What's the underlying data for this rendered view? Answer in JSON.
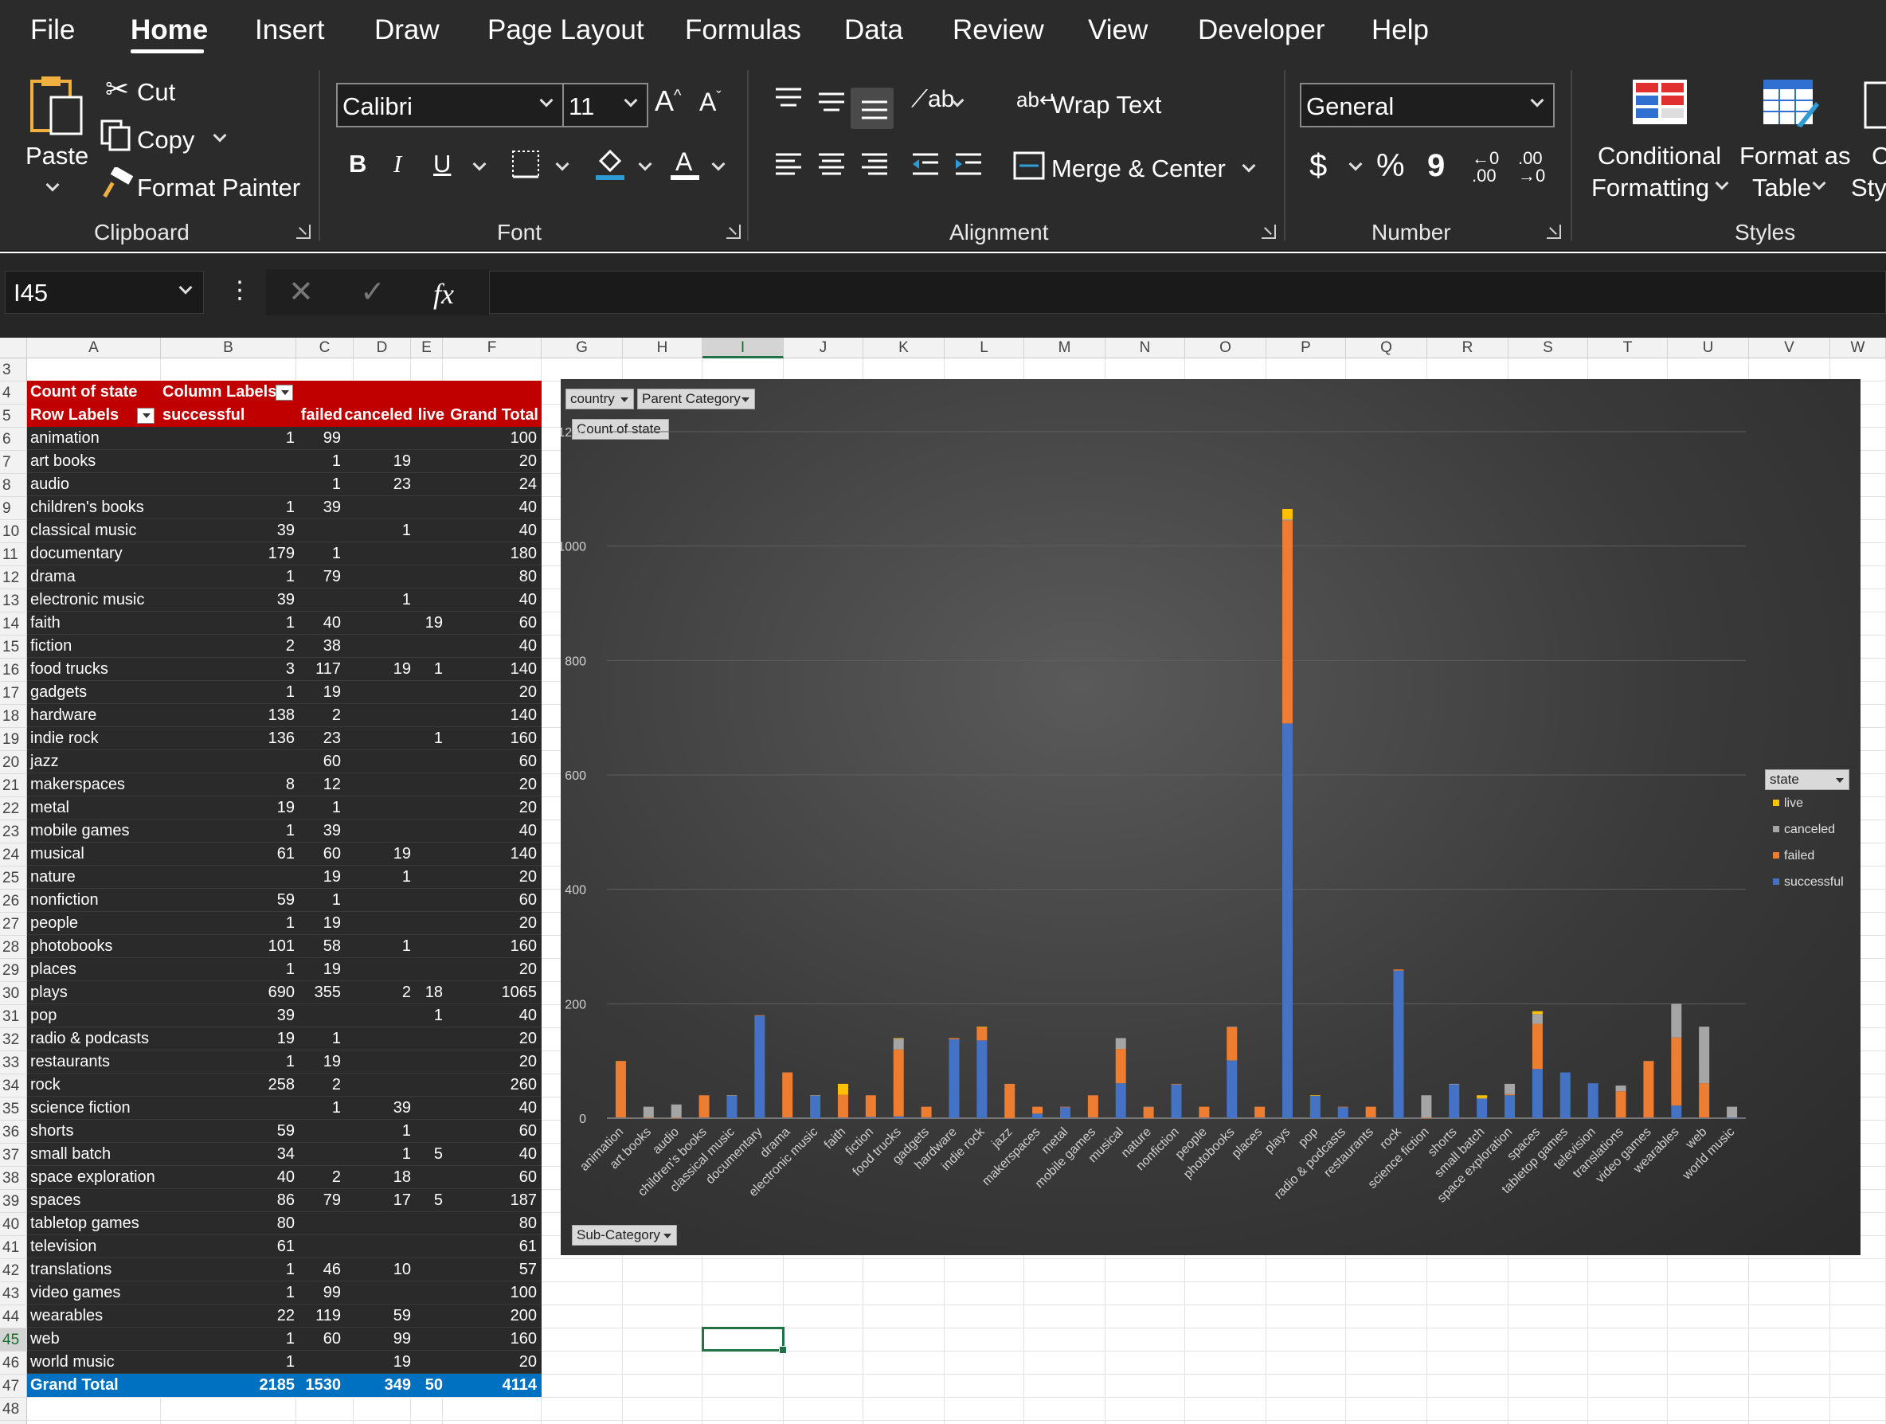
{
  "ribbon": {
    "tabs": [
      "File",
      "Home",
      "Insert",
      "Draw",
      "Page Layout",
      "Formulas",
      "Data",
      "Review",
      "View",
      "Developer",
      "Help"
    ],
    "active_tab": "Home",
    "clipboard": {
      "paste": "Paste",
      "cut": "Cut",
      "copy": "Copy",
      "format_painter": "Format Painter",
      "label": "Clipboard"
    },
    "font": {
      "name": "Calibri",
      "size": "11",
      "label": "Font",
      "bold": "B",
      "italic": "I",
      "underline": "U"
    },
    "alignment": {
      "wrap_text": "Wrap Text",
      "merge_center": "Merge & Center",
      "label": "Alignment"
    },
    "number": {
      "format": "General",
      "currency": "$",
      "percent": "%",
      "comma": "9",
      "label": "Number"
    },
    "styles": {
      "conditional_1": "Conditional",
      "conditional_2": "Formatting",
      "format_table_1": "Format as",
      "format_table_2": "Table",
      "cell_styles_1": "C",
      "cell_styles_2": "Sty",
      "label": "Styles"
    }
  },
  "formula_bar": {
    "name_box": "I45",
    "fx": "fx",
    "formula": ""
  },
  "grid": {
    "columns": [
      "A",
      "B",
      "C",
      "D",
      "E",
      "F",
      "G",
      "H",
      "I",
      "J",
      "K",
      "L",
      "M",
      "N",
      "O",
      "P",
      "Q",
      "R",
      "S",
      "T",
      "U",
      "V",
      "W"
    ],
    "selected_column": "I",
    "rows": [
      "3",
      "4",
      "5",
      "6",
      "7",
      "8",
      "9",
      "10",
      "11",
      "12",
      "13",
      "14",
      "15",
      "16",
      "17",
      "18",
      "19",
      "20",
      "21",
      "22",
      "23",
      "24",
      "25",
      "26",
      "27",
      "28",
      "29",
      "30",
      "31",
      "32",
      "33",
      "34",
      "35",
      "36",
      "37",
      "38",
      "39",
      "40",
      "41",
      "42",
      "43",
      "44",
      "45",
      "46",
      "47",
      "48"
    ],
    "selected_row": "45"
  },
  "pivot": {
    "title": "Count of state",
    "column_labels": "Column Labels",
    "row_labels": "Row Labels",
    "headers": [
      "successful",
      "failed",
      "canceled",
      "live",
      "Grand Total"
    ],
    "rows": [
      {
        "label": "animation",
        "v": [
          "1",
          "99",
          "",
          "",
          "100"
        ]
      },
      {
        "label": "art books",
        "v": [
          "",
          "1",
          "19",
          "",
          "20"
        ]
      },
      {
        "label": "audio",
        "v": [
          "",
          "1",
          "23",
          "",
          "24"
        ]
      },
      {
        "label": "children's books",
        "v": [
          "1",
          "39",
          "",
          "",
          "40"
        ]
      },
      {
        "label": "classical music",
        "v": [
          "39",
          "",
          "1",
          "",
          "40"
        ]
      },
      {
        "label": "documentary",
        "v": [
          "179",
          "1",
          "",
          "",
          "180"
        ]
      },
      {
        "label": "drama",
        "v": [
          "1",
          "79",
          "",
          "",
          "80"
        ]
      },
      {
        "label": "electronic music",
        "v": [
          "39",
          "",
          "1",
          "",
          "40"
        ]
      },
      {
        "label": "faith",
        "v": [
          "1",
          "40",
          "",
          "19",
          "60"
        ]
      },
      {
        "label": "fiction",
        "v": [
          "2",
          "38",
          "",
          "",
          "40"
        ]
      },
      {
        "label": "food trucks",
        "v": [
          "3",
          "117",
          "19",
          "1",
          "140"
        ]
      },
      {
        "label": "gadgets",
        "v": [
          "1",
          "19",
          "",
          "",
          "20"
        ]
      },
      {
        "label": "hardware",
        "v": [
          "138",
          "2",
          "",
          "",
          "140"
        ]
      },
      {
        "label": "indie rock",
        "v": [
          "136",
          "23",
          "",
          "1",
          "160"
        ]
      },
      {
        "label": "jazz",
        "v": [
          "",
          "60",
          "",
          "",
          "60"
        ]
      },
      {
        "label": "makerspaces",
        "v": [
          "8",
          "12",
          "",
          "",
          "20"
        ]
      },
      {
        "label": "metal",
        "v": [
          "19",
          "1",
          "",
          "",
          "20"
        ]
      },
      {
        "label": "mobile games",
        "v": [
          "1",
          "39",
          "",
          "",
          "40"
        ]
      },
      {
        "label": "musical",
        "v": [
          "61",
          "60",
          "19",
          "",
          "140"
        ]
      },
      {
        "label": "nature",
        "v": [
          "",
          "19",
          "1",
          "",
          "20"
        ]
      },
      {
        "label": "nonfiction",
        "v": [
          "59",
          "1",
          "",
          "",
          "60"
        ]
      },
      {
        "label": "people",
        "v": [
          "1",
          "19",
          "",
          "",
          "20"
        ]
      },
      {
        "label": "photobooks",
        "v": [
          "101",
          "58",
          "1",
          "",
          "160"
        ]
      },
      {
        "label": "places",
        "v": [
          "1",
          "19",
          "",
          "",
          "20"
        ]
      },
      {
        "label": "plays",
        "v": [
          "690",
          "355",
          "2",
          "18",
          "1065"
        ]
      },
      {
        "label": "pop",
        "v": [
          "39",
          "",
          "",
          "1",
          "40"
        ]
      },
      {
        "label": "radio & podcasts",
        "v": [
          "19",
          "1",
          "",
          "",
          "20"
        ]
      },
      {
        "label": "restaurants",
        "v": [
          "1",
          "19",
          "",
          "",
          "20"
        ]
      },
      {
        "label": "rock",
        "v": [
          "258",
          "2",
          "",
          "",
          "260"
        ]
      },
      {
        "label": "science fiction",
        "v": [
          "",
          "1",
          "39",
          "",
          "40"
        ]
      },
      {
        "label": "shorts",
        "v": [
          "59",
          "",
          "1",
          "",
          "60"
        ]
      },
      {
        "label": "small batch",
        "v": [
          "34",
          "",
          "1",
          "5",
          "40"
        ]
      },
      {
        "label": "space exploration",
        "v": [
          "40",
          "2",
          "18",
          "",
          "60"
        ]
      },
      {
        "label": "spaces",
        "v": [
          "86",
          "79",
          "17",
          "5",
          "187"
        ]
      },
      {
        "label": "tabletop games",
        "v": [
          "80",
          "",
          "",
          "",
          "80"
        ]
      },
      {
        "label": "television",
        "v": [
          "61",
          "",
          "",
          "",
          "61"
        ]
      },
      {
        "label": "translations",
        "v": [
          "1",
          "46",
          "10",
          "",
          "57"
        ]
      },
      {
        "label": "video games",
        "v": [
          "1",
          "99",
          "",
          "",
          "100"
        ]
      },
      {
        "label": "wearables",
        "v": [
          "22",
          "119",
          "59",
          "",
          "200"
        ]
      },
      {
        "label": "web",
        "v": [
          "1",
          "60",
          "99",
          "",
          "160"
        ]
      },
      {
        "label": "world music",
        "v": [
          "1",
          "",
          "19",
          "",
          "20"
        ]
      }
    ],
    "grand_total": {
      "label": "Grand Total",
      "v": [
        "2185",
        "1530",
        "349",
        "50",
        "4114"
      ]
    }
  },
  "chart_ui": {
    "filter_country": "country",
    "filter_parent": "Parent Category",
    "value_button": "Count of state",
    "axis_button": "Sub-Category",
    "legend_button": "state"
  },
  "colors": {
    "successful": "#4472c4",
    "failed": "#ed7d31",
    "canceled": "#a5a5a5",
    "live": "#ffc000",
    "pivot_header": "#c00000",
    "pivot_total": "#0070c0",
    "ribbon_bg": "#2b2b2b"
  },
  "chart_data": {
    "type": "bar",
    "stacked": true,
    "categories": [
      "animation",
      "art books",
      "audio",
      "children's books",
      "classical music",
      "documentary",
      "drama",
      "electronic music",
      "faith",
      "fiction",
      "food trucks",
      "gadgets",
      "hardware",
      "indie rock",
      "jazz",
      "makerspaces",
      "metal",
      "mobile games",
      "musical",
      "nature",
      "nonfiction",
      "people",
      "photobooks",
      "places",
      "plays",
      "pop",
      "radio & podcasts",
      "restaurants",
      "rock",
      "science fiction",
      "shorts",
      "small batch",
      "space exploration",
      "spaces",
      "tabletop games",
      "television",
      "translations",
      "video games",
      "wearables",
      "web",
      "world music"
    ],
    "series": [
      {
        "name": "successful",
        "values": [
          1,
          0,
          0,
          1,
          39,
          179,
          1,
          39,
          1,
          2,
          3,
          1,
          138,
          136,
          0,
          8,
          19,
          1,
          61,
          0,
          59,
          1,
          101,
          1,
          690,
          39,
          19,
          1,
          258,
          0,
          59,
          34,
          40,
          86,
          80,
          61,
          1,
          1,
          22,
          1,
          1
        ]
      },
      {
        "name": "failed",
        "values": [
          99,
          1,
          1,
          39,
          0,
          1,
          79,
          0,
          40,
          38,
          117,
          19,
          2,
          23,
          60,
          12,
          1,
          39,
          60,
          19,
          1,
          19,
          58,
          19,
          355,
          0,
          1,
          19,
          2,
          1,
          0,
          0,
          2,
          79,
          0,
          0,
          46,
          99,
          119,
          60,
          0
        ]
      },
      {
        "name": "canceled",
        "values": [
          0,
          19,
          23,
          0,
          1,
          0,
          0,
          1,
          0,
          0,
          19,
          0,
          0,
          0,
          0,
          0,
          0,
          0,
          19,
          1,
          0,
          0,
          1,
          0,
          2,
          0,
          0,
          0,
          0,
          39,
          1,
          1,
          18,
          17,
          0,
          0,
          10,
          0,
          59,
          99,
          19
        ]
      },
      {
        "name": "live",
        "values": [
          0,
          0,
          0,
          0,
          0,
          0,
          0,
          0,
          19,
          0,
          1,
          0,
          0,
          1,
          0,
          0,
          0,
          0,
          0,
          0,
          0,
          0,
          0,
          0,
          18,
          1,
          0,
          0,
          0,
          0,
          0,
          5,
          0,
          5,
          0,
          0,
          0,
          0,
          0,
          0,
          0
        ]
      }
    ],
    "legend_order": [
      "live",
      "canceled",
      "failed",
      "successful"
    ],
    "ylim": [
      0,
      1200
    ],
    "yticks": [
      "0",
      "200",
      "400",
      "600",
      "800",
      "1000",
      "1200"
    ],
    "grid": true,
    "legend_position": "right"
  }
}
